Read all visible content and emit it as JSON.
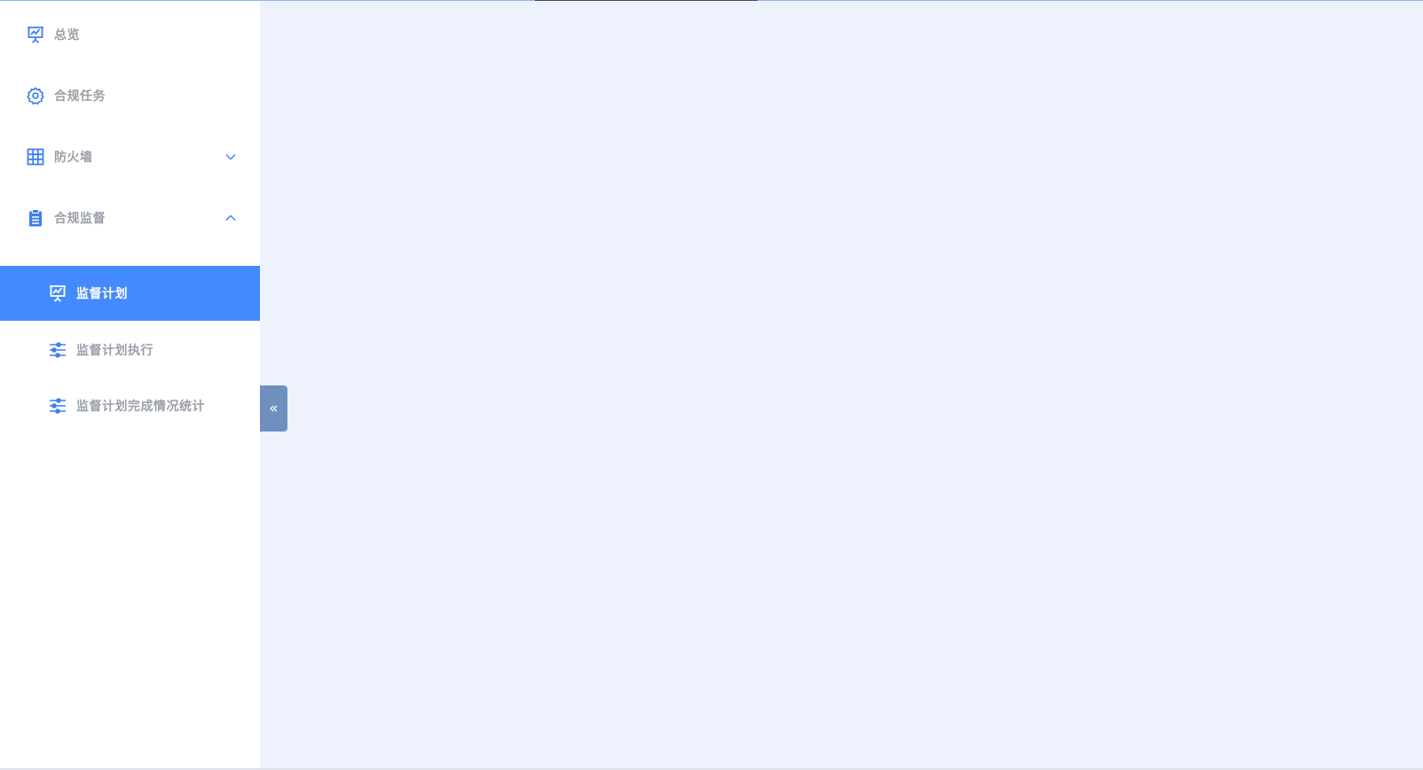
{
  "sidebar": {
    "items": [
      {
        "label": "总览",
        "icon": "presentation-chart-icon"
      },
      {
        "label": "合规任务",
        "icon": "gear-icon"
      },
      {
        "label": "防火墙",
        "icon": "grid-table-icon",
        "expanded": false
      },
      {
        "label": "合规监督",
        "icon": "clipboard-icon",
        "expanded": true
      }
    ],
    "sub_items": [
      {
        "label": "监督计划",
        "icon": "presentation-chart-icon",
        "active": true
      },
      {
        "label": "监督计划执行",
        "icon": "sliders-icon",
        "active": false
      },
      {
        "label": "监督计划完成情况统计",
        "icon": "sliders-icon",
        "active": false
      }
    ],
    "collapse_button_glyph": "«"
  },
  "colors": {
    "accent": "#448aff",
    "icon_blue": "#3f7ef0",
    "main_bg": "#edf2fd",
    "text_muted": "#9a9fa8",
    "collapse_bg": "#6f8fbf"
  }
}
